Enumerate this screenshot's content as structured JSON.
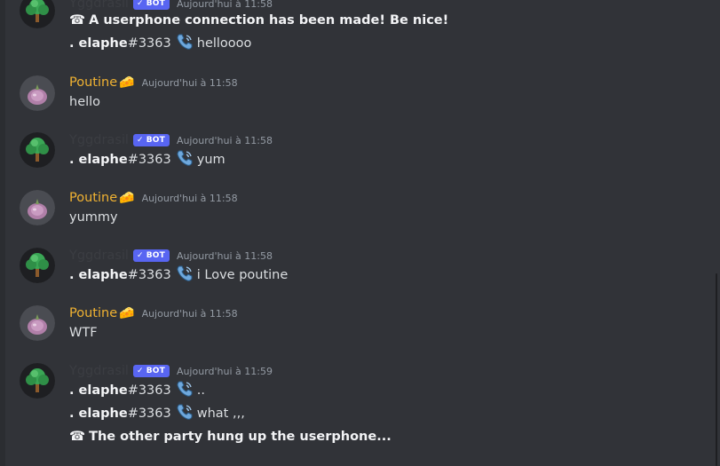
{
  "colors": {
    "background": "#313338",
    "bot_name": "#3b3d42",
    "user_name": "#f0b232",
    "bot_badge": "#5865f2",
    "timestamp": "#949ba4",
    "text": "#dbdee1"
  },
  "bot": {
    "name": "Yggdrasil",
    "badge": "BOT",
    "badge_check": "✓"
  },
  "user": {
    "name": "Poutine",
    "emoji": "🧀"
  },
  "timestamps": {
    "t1158": "Aujourd'hui à 11:58",
    "t1159": "Aujourd'hui à 11:59"
  },
  "relay": {
    "sender": ". elaphe",
    "tag": "#3363"
  },
  "messages": {
    "g1": {
      "line1": "A userphone connection has been made! Be nice!",
      "line2": "helloooo"
    },
    "g2": {
      "line1": "hello"
    },
    "g3": {
      "line1": "yum"
    },
    "g4": {
      "line1": "yummy"
    },
    "g5": {
      "line1": "i Love poutine"
    },
    "g6": {
      "line1": "WTF"
    },
    "g7": {
      "line1": "..",
      "line2": "what ,,,",
      "line3": "The other party hung up the userphone..."
    }
  },
  "icons": {
    "phone_glyph": "☎",
    "call_icon": "telephone-receiver-icon",
    "bot_avatar": "tree-icon",
    "user_avatar": "onion-icon"
  }
}
